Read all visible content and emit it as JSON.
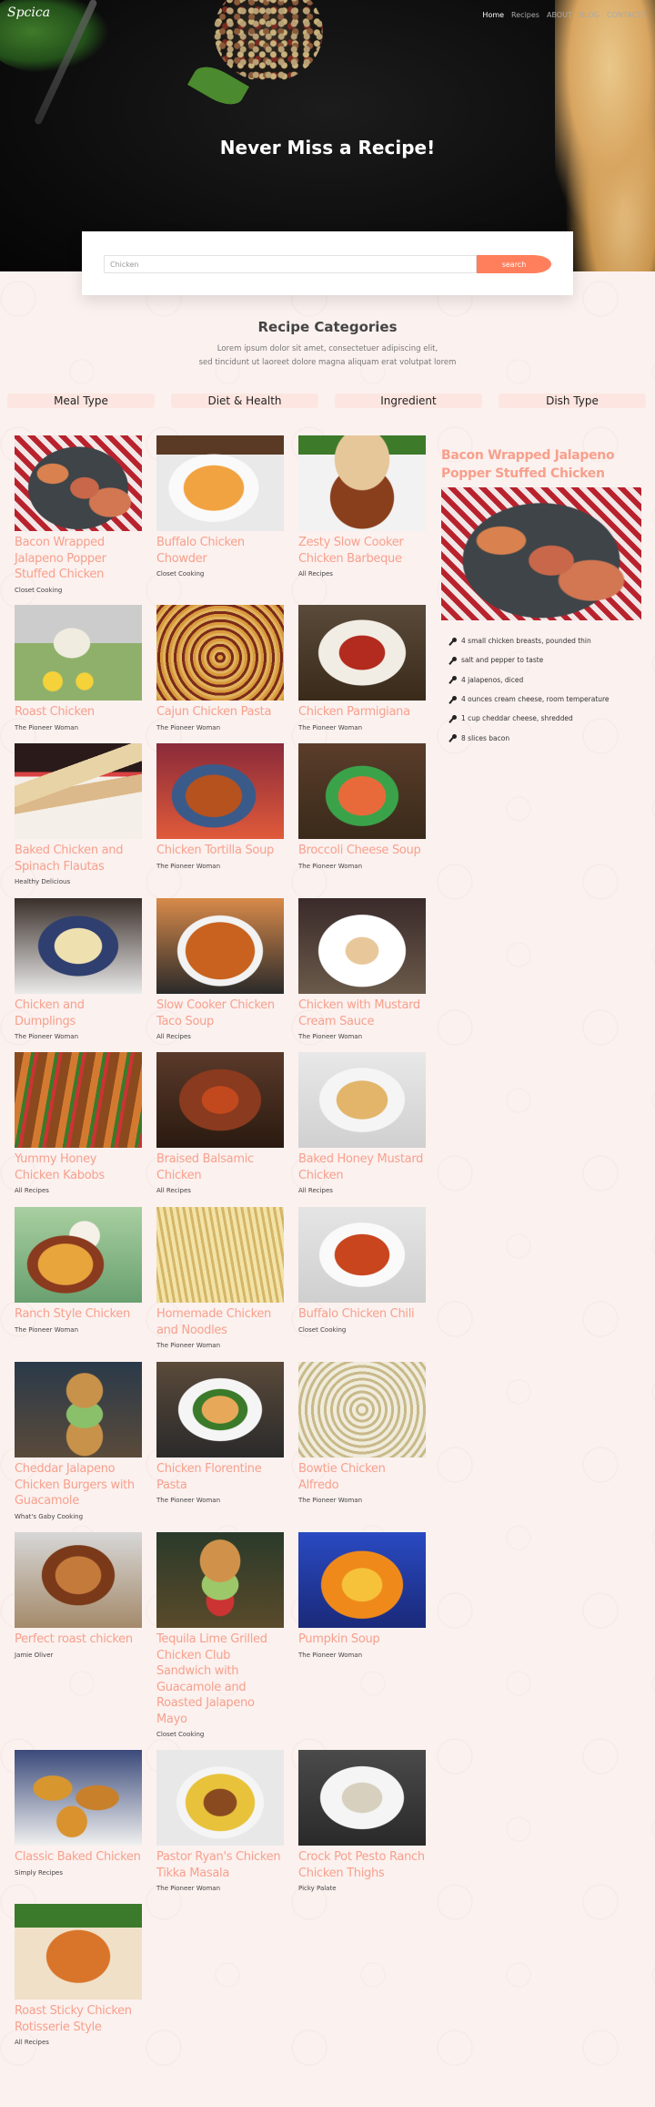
{
  "header": {
    "logo": "Spcica",
    "nav": [
      {
        "label": "Home",
        "active": true
      },
      {
        "label": "Recipes",
        "active": false
      },
      {
        "label": "ABOUT",
        "active": false
      },
      {
        "label": "BLOG",
        "active": false
      },
      {
        "label": "CONTACTS",
        "active": false
      }
    ],
    "hero_title": "Never Miss a Recipe!"
  },
  "search": {
    "value": "Chicken",
    "button_label": "search"
  },
  "categories": {
    "title": "Recipe Categories",
    "subtitle_line1": "Lorem ipsum dolor sit amet, consectetuer adipiscing elit,",
    "subtitle_line2": "sed tincidunt ut laoreet dolore magna aliquam erat volutpat lorem",
    "tabs": [
      "Meal Type",
      "Diet & Health",
      "Ingredient",
      "Dish Type"
    ]
  },
  "colors": {
    "accent": "#ff7f5c",
    "title_pink": "#f7a08c",
    "page_bg": "#fbf1ef",
    "tab_bg": "#fde6e1"
  },
  "recipes": [
    {
      "title": "Bacon Wrapped Jalapeno Popper Stuffed Chicken",
      "source": "Closet Cooking",
      "img": "bacon-chicken"
    },
    {
      "title": "Buffalo Chicken Chowder",
      "source": "Closet Cooking",
      "img": "chowder"
    },
    {
      "title": "Zesty Slow Cooker Chicken Barbeque",
      "source": "All Recipes",
      "img": "bbq-sandwich"
    },
    {
      "title": "Roast Chicken",
      "source": "The Pioneer Woman",
      "img": "roast-chicken"
    },
    {
      "title": "Cajun Chicken Pasta",
      "source": "The Pioneer Woman",
      "img": "pasta"
    },
    {
      "title": "Chicken Parmigiana",
      "source": "The Pioneer Woman",
      "img": "parmigiana"
    },
    {
      "title": "Baked Chicken and Spinach Flautas",
      "source": "Healthy Delicious",
      "img": "flautas"
    },
    {
      "title": "Chicken Tortilla Soup",
      "source": "The Pioneer Woman",
      "img": "tortilla-soup"
    },
    {
      "title": "Broccoli Cheese Soup",
      "source": "The Pioneer Woman",
      "img": "broccoli-soup"
    },
    {
      "title": "Chicken and Dumplings",
      "source": "The Pioneer Woman",
      "img": "dumplings"
    },
    {
      "title": "Slow Cooker Chicken Taco Soup",
      "source": "All Recipes",
      "img": "taco-soup"
    },
    {
      "title": "Chicken with Mustard Cream Sauce",
      "source": "The Pioneer Woman",
      "img": "mustard-chicken"
    },
    {
      "title": "Yummy Honey Chicken Kabobs",
      "source": "All Recipes",
      "img": "kabobs"
    },
    {
      "title": "Braised Balsamic Chicken",
      "source": "All Recipes",
      "img": "balsamic"
    },
    {
      "title": "Baked Honey Mustard Chicken",
      "source": "All Recipes",
      "img": "honey-mustard"
    },
    {
      "title": "Ranch Style Chicken",
      "source": "The Pioneer Woman",
      "img": "ranch"
    },
    {
      "title": "Homemade Chicken and Noodles",
      "source": "The Pioneer Woman",
      "img": "noodles"
    },
    {
      "title": "Buffalo Chicken Chili",
      "source": "Closet Cooking",
      "img": "chili"
    },
    {
      "title": "Cheddar Jalapeno Chicken Burgers with Guacamole",
      "source": "What's Gaby Cooking",
      "img": "burger"
    },
    {
      "title": "Chicken Florentine Pasta",
      "source": "The Pioneer Woman",
      "img": "florentine"
    },
    {
      "title": "Bowtie Chicken Alfredo",
      "source": "The Pioneer Woman",
      "img": "alfredo"
    },
    {
      "title": "Perfect roast chicken",
      "source": "Jamie Oliver",
      "img": "perfect-roast"
    },
    {
      "title": "Tequila Lime Grilled Chicken Club Sandwich with Guacamole and Roasted Jalapeno Mayo",
      "source": "Closet Cooking",
      "img": "club-sandwich"
    },
    {
      "title": "Pumpkin Soup",
      "source": "The Pioneer Woman",
      "img": "pumpkin-soup"
    },
    {
      "title": "Classic Baked Chicken",
      "source": "Simply Recipes",
      "img": "baked-chicken"
    },
    {
      "title": "Pastor Ryan's Chicken Tikka Masala",
      "source": "The Pioneer Woman",
      "img": "tikka"
    },
    {
      "title": "Crock Pot Pesto Ranch Chicken Thighs",
      "source": "Picky Palate",
      "img": "pesto-thighs"
    },
    {
      "title": "Roast Sticky Chicken Rotisserie Style",
      "source": "All Recipes",
      "img": "sticky-chicken"
    }
  ],
  "featured": {
    "title": "Bacon Wrapped Jalapeno Popper Stuffed Chicken",
    "img": "bacon-chicken",
    "ingredients": [
      "4 small chicken breasts, pounded thin",
      "salt and pepper to taste",
      "4 jalapenos, diced",
      "4 ounces cream cheese, room temperature",
      "1 cup cheddar cheese, shredded",
      "8 slices bacon"
    ]
  }
}
